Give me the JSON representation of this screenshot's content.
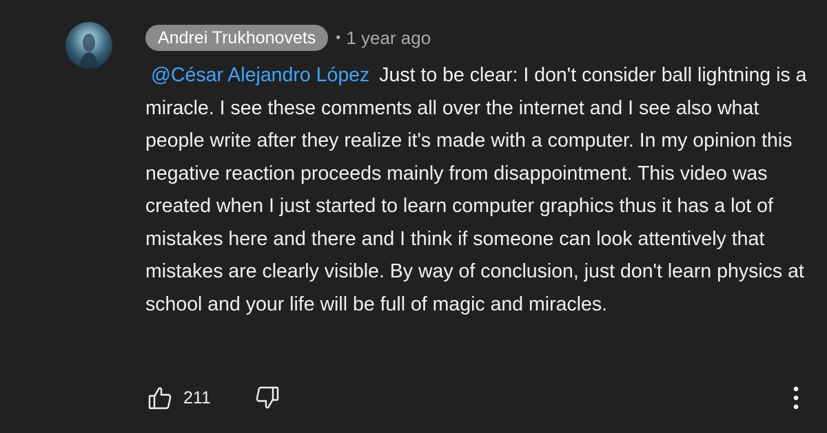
{
  "comment": {
    "author": "Andrei Trukhonovets",
    "separator": "•",
    "timestamp": "1 year ago",
    "mention": "@César Alejandro López",
    "body": "Just to be clear: I don't consider ball lightning is a miracle. I see these comments all over the internet and I see also what people write after they realize it's made with a computer. In my opinion this negative reaction proceeds mainly from disappointment. This video was created when I just started to learn computer graphics thus it has a lot of mistakes here and there and I think if someone can look attentively that mistakes are clearly visible. By way of conclusion, just don't learn physics at school and your life will be full of magic and miracles.",
    "like_count": "211"
  },
  "icons": {
    "avatar": "avatar-image",
    "like": "thumbs-up-icon",
    "dislike": "thumbs-down-icon",
    "more": "more-vertical-icon"
  },
  "colors": {
    "background": "#212121",
    "text": "#f1f1f1",
    "secondary_text": "#aaaaaa",
    "author_chip": "#8a8a8a",
    "mention_link": "#3ea6ff"
  }
}
